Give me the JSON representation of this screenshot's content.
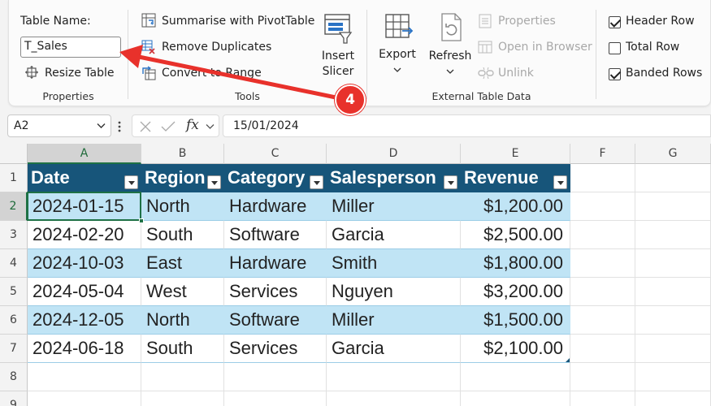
{
  "ribbon": {
    "properties": {
      "table_name_label": "Table Name:",
      "table_name_value": "T_Sales",
      "resize_label": "Resize Table",
      "group_label": "Properties"
    },
    "tools": {
      "summarise_label": "Summarise with PivotTable",
      "remove_duplicates_label": "Remove Duplicates",
      "convert_label": "Convert to Range",
      "slicer_label_1": "Insert",
      "slicer_label_2": "Slicer",
      "group_label": "Tools"
    },
    "external": {
      "export_label": "Export",
      "refresh_label": "Refresh",
      "properties_label": "Properties",
      "open_browser_label": "Open in Browser",
      "unlink_label": "Unlink",
      "group_label": "External Table Data"
    },
    "style_options": {
      "header_row_label": "Header Row",
      "header_row_checked": true,
      "total_row_label": "Total Row",
      "total_row_checked": false,
      "banded_rows_label": "Banded Rows",
      "banded_rows_checked": true
    }
  },
  "formula_bar": {
    "cell_ref": "A2",
    "fx_symbol": "fx",
    "value": "15/01/2024"
  },
  "annotation": {
    "step_number": "4"
  },
  "sheet": {
    "columns": [
      "A",
      "B",
      "C",
      "D",
      "E",
      "F",
      "G"
    ],
    "rows": [
      "1",
      "2",
      "3",
      "4",
      "5",
      "6",
      "7",
      "8",
      "9"
    ],
    "table": {
      "headers": [
        "Date",
        "Region",
        "Category",
        "Salesperson",
        "Revenue"
      ],
      "data": [
        [
          "2024-01-15",
          "North",
          "Hardware",
          "Miller",
          "$1,200.00"
        ],
        [
          "2024-02-20",
          "South",
          "Software",
          "Garcia",
          "$2,500.00"
        ],
        [
          "2024-10-03",
          "East",
          "Hardware",
          "Smith",
          "$1,800.00"
        ],
        [
          "2024-05-04",
          "West",
          "Services",
          "Nguyen",
          "$3,200.00"
        ],
        [
          "2024-12-05",
          "North",
          "Software",
          "Miller",
          "$1,500.00"
        ],
        [
          "2024-06-18",
          "South",
          "Services",
          "Garcia",
          "$2,100.00"
        ]
      ]
    }
  },
  "colors": {
    "header_fill": "#17557a",
    "band_fill": "#c0e4f5",
    "accent_green": "#1e7145",
    "annotation_red": "#e8312b"
  }
}
